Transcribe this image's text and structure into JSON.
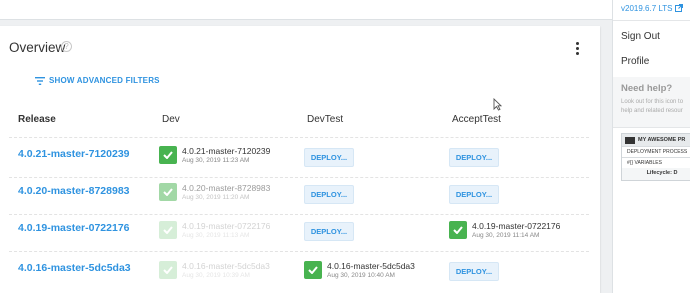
{
  "overview": {
    "title": "Overview",
    "help_glyph": "?",
    "show_filters": "SHOW ADVANCED FILTERS"
  },
  "table": {
    "headers": [
      "Release",
      "Dev",
      "DevTest",
      "AcceptTest"
    ],
    "deploy_label": "DEPLOY...",
    "rows": [
      {
        "release": "4.0.21-master-7120239",
        "dev": {
          "version": "4.0.21-master-7120239",
          "date": "Aug 30, 2019 11:23 AM"
        }
      },
      {
        "release": "4.0.20-master-8728983",
        "dev": {
          "version": "4.0.20-master-8728983",
          "date": "Aug 30, 2019 11:20 AM"
        }
      },
      {
        "release": "4.0.19-master-0722176",
        "dev": {
          "version": "4.0.19-master-0722176",
          "date": "Aug 30, 2019 11:13 AM"
        },
        "accepttest": {
          "version": "4.0.19-master-0722176",
          "date": "Aug 30, 2019 11:14 AM"
        }
      },
      {
        "release": "4.0.16-master-5dc5da3",
        "dev": {
          "version": "4.0.16-master-5dc5da3",
          "date": "Aug 30, 2019 10:39 AM"
        },
        "devtest": {
          "version": "4.0.16-master-5dc5da3",
          "date": "Aug 30, 2019 10:40 AM"
        }
      }
    ]
  },
  "sidebar": {
    "version": "v2019.6.7 LTS",
    "sign_out": "Sign Out",
    "profile": "Profile",
    "need_help": "Need help?",
    "help_line1": "Look out for this icon to",
    "help_line2": "help and related resour",
    "mini": {
      "title": "MY AWESOME PR",
      "process": "DEPLOYMENT PROCESS",
      "variables": "#{} VARIABLES",
      "lifecycle": "Lifecycle: D"
    }
  },
  "colors": {
    "accent": "#2f93e0",
    "success": "#48b350"
  }
}
